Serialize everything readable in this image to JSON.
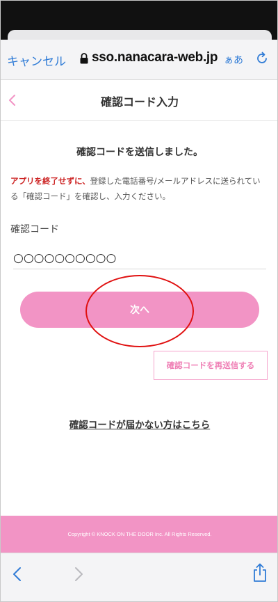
{
  "browser": {
    "cancel_label": "キャンセル",
    "url": "sso.nanacara-web.jp",
    "text_size_label": "ぁあ"
  },
  "header": {
    "title": "確認コード入力"
  },
  "main": {
    "sent_message": "確認コードを送信しました。",
    "instruction_warning": "アプリを終了せずに、",
    "instruction_text": "登録した電話番号/メールアドレスに送られている「確認コード」を確認し、入力ください。",
    "code_label": "確認コード",
    "code_value": "○○○○○○○○○○",
    "next_label": "次へ",
    "resend_label": "確認コードを再送信する",
    "help_link": "確認コードが届かない方はこちら"
  },
  "footer": {
    "copyright": "Copyright © KNOCK ON THE DOOR Inc. All Rights Reserved."
  },
  "colors": {
    "accent_pink": "#f294c5",
    "warning_red": "#cc2222",
    "ios_blue": "#2f7bd6",
    "annotation_red": "#e01010"
  }
}
